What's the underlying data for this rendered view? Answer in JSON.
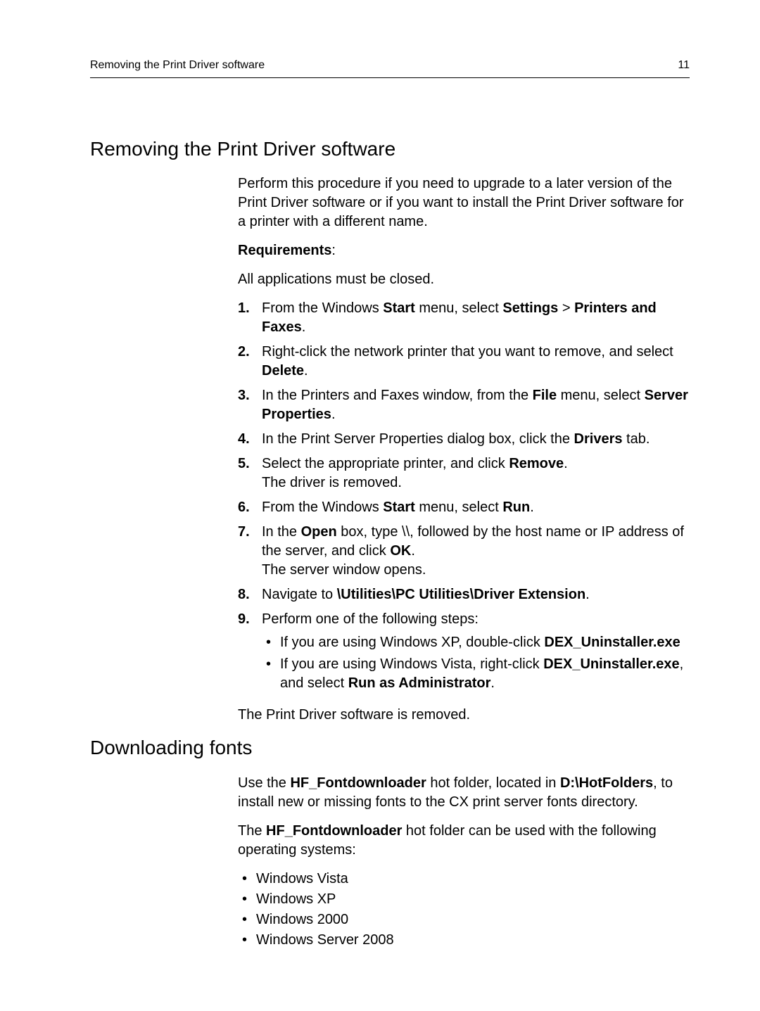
{
  "header": {
    "left": "Removing the Print Driver software",
    "page_number": "11"
  },
  "section1": {
    "title": "Removing the Print Driver software",
    "intro": "Perform this procedure if you need to upgrade to a later version of the Print Driver software or if you want to install the Print Driver software for a printer with a different name.",
    "req_label": "Requirements",
    "req_text": "All applications must be closed.",
    "s1": {
      "a": "From the Windows ",
      "b": "Start",
      "c": " menu, select  ",
      "d": "Settings",
      "e": "  > ",
      "f": "Printers and Faxes",
      "g": "."
    },
    "s2": {
      "a": "Right-click the network printer that you want to remove, and select ",
      "b": "Delete",
      "c": "."
    },
    "s3": {
      "a": "In the Printers and Faxes window, from the ",
      "b": "File",
      "c": " menu, select ",
      "d": "Server Properties",
      "e": "."
    },
    "s4": {
      "a": "In the Print Server Properties dialog box, click the ",
      "b": "Drivers",
      "c": " tab."
    },
    "s5": {
      "a": "Select the appropriate printer, and click ",
      "b": "Remove",
      "c": ".",
      "d": "The driver is removed."
    },
    "s6": {
      "a": "From the Windows ",
      "b": "Start",
      "c": " menu, select ",
      "d": "Run",
      "e": "."
    },
    "s7": {
      "a": "In the ",
      "b": "Open",
      "c": " box, type \\\\, followed by the host name or IP address of the server, and click ",
      "d": "OK",
      "e": ".",
      "f": "The server window opens."
    },
    "s8": {
      "a": "Navigate to ",
      "b": "\\Utilities\\PC Utilities\\Driver Extension",
      "c": "."
    },
    "s9": {
      "a": "Perform one of the following steps:",
      "b1a": "If you are using Windows XP, double-click ",
      "b1b": "DEX_Uninstaller.exe",
      "b2a": "If you are using Windows Vista, right-click ",
      "b2b": "DEX_Uninstaller.exe",
      "b2c": ", and select ",
      "b2d": "Run as Administrator",
      "b2e": "."
    },
    "outro": "The Print Driver software is removed."
  },
  "section2": {
    "title": "Downloading fonts",
    "p1": {
      "a": "Use the ",
      "b": "HF_Fontdownloader",
      "c": " hot folder, located in ",
      "d": "D:\\HotFolders",
      "e": ", to install new or missing fonts to the CX print server fonts directory."
    },
    "p2": {
      "a": "The ",
      "b": "HF_Fontdownloader",
      "c": " hot folder can be used with the following operating systems:"
    },
    "os": [
      "Windows Vista",
      "Windows XP",
      "Windows 2000",
      "Windows Server 2008"
    ]
  }
}
